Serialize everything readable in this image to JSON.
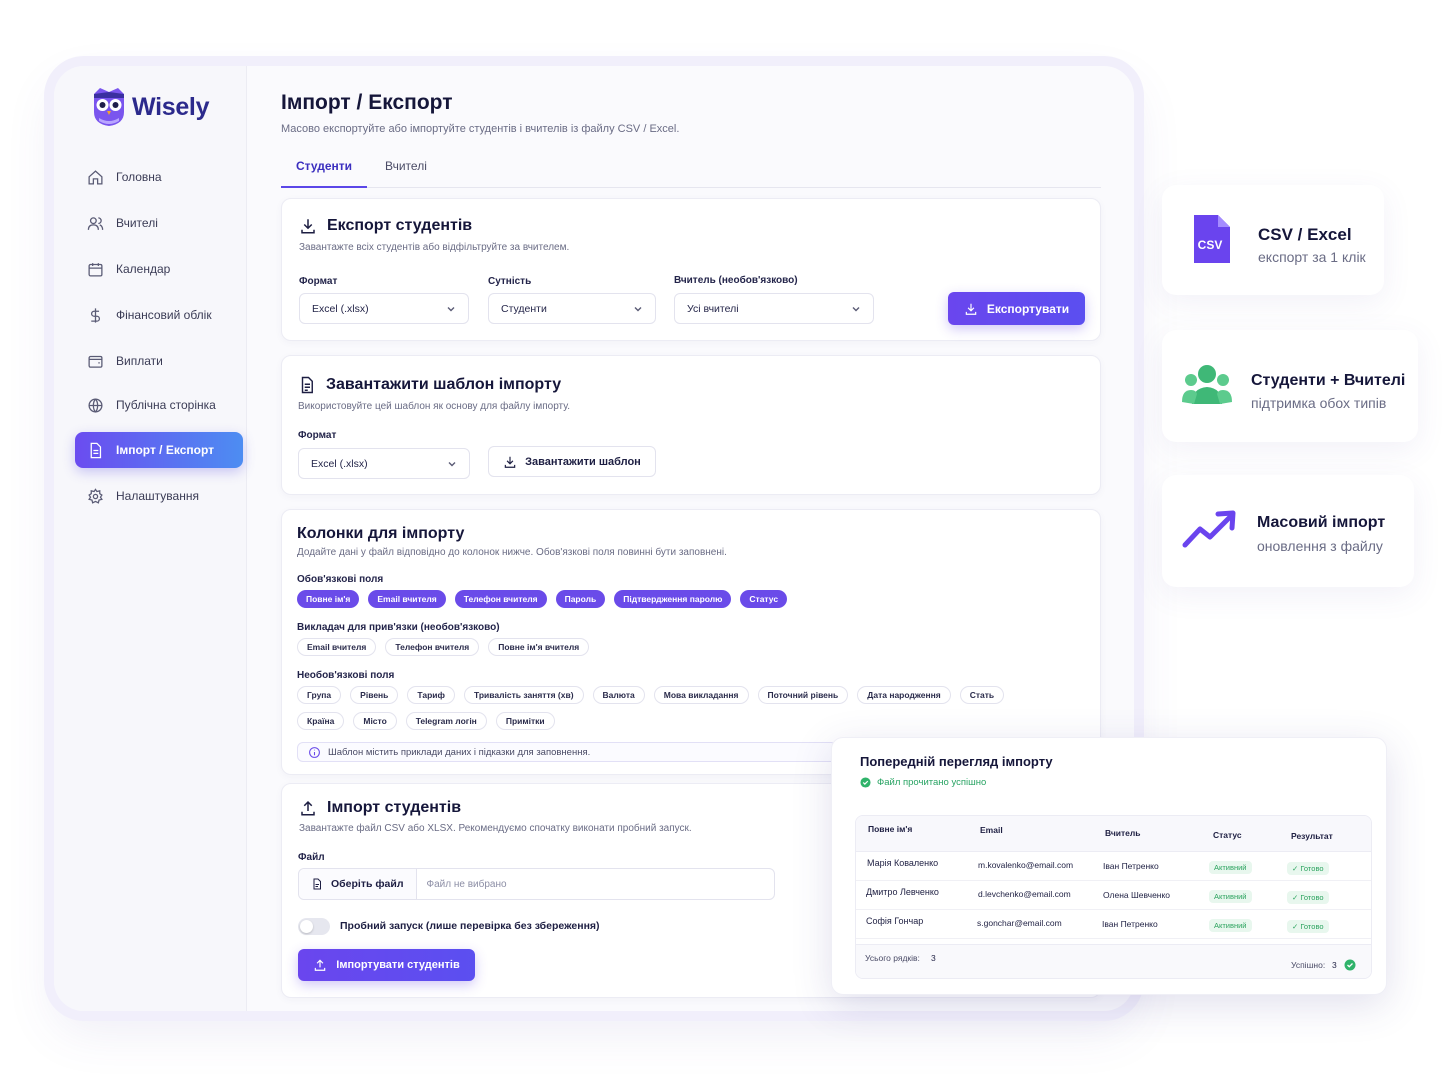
{
  "app": {
    "name": "Wisely"
  },
  "sidebar": {
    "items": [
      {
        "label": "Головна",
        "icon": "home-icon"
      },
      {
        "label": "Вчителі",
        "icon": "users-icon"
      },
      {
        "label": "Календар",
        "icon": "calendar-icon"
      },
      {
        "label": "Фінансовий облік",
        "icon": "dollar-icon"
      },
      {
        "label": "Виплати",
        "icon": "wallet-icon"
      },
      {
        "label": "Публічна сторінка",
        "icon": "globe-icon"
      },
      {
        "label": "Імпорт / Експорт",
        "icon": "file-icon",
        "active": true
      },
      {
        "label": "Налаштування",
        "icon": "gear-icon"
      }
    ]
  },
  "page": {
    "title": "Імпорт / Експорт",
    "subtitle": "Масово експортуйте або імпортуйте студентів і вчителів із файлу CSV / Excel.",
    "tabs": [
      {
        "label": "Студенти",
        "active": true
      },
      {
        "label": "Вчителі",
        "active": false
      }
    ]
  },
  "export_card": {
    "title": "Експорт студентів",
    "subtitle": "Завантажте всіх студентів або відфільтруйте за вчителем.",
    "format_label": "Формат",
    "format_value": "Excel (.xlsx)",
    "entity_label": "Сутність",
    "entity_value": "Студенти",
    "teacher_label": "Вчитель (необов'язково)",
    "teacher_value": "Усі вчителі",
    "button": "Експортувати"
  },
  "template_card": {
    "title": "Завантажити шаблон імпорту",
    "subtitle": "Використовуйте цей шаблон як основу для файлу імпорту.",
    "format_label": "Формат",
    "format_value": "Excel (.xlsx)",
    "button": "Завантажити шаблон"
  },
  "columns_card": {
    "title": "Колонки для імпорту",
    "subtitle": "Додайте дані у файл відповідно до колонок нижче. Обов'язкові поля повинні бути заповнені.",
    "required_label": "Обов'язкові поля",
    "required": [
      "Повне ім'я",
      "Email вчителя",
      "Телефон вчителя",
      "Пароль",
      "Підтвердження паролю",
      "Статус"
    ],
    "teacher_link_label": "Викладач для прив'язки (необов'язково)",
    "teacher_link": [
      "Email вчителя",
      "Телефон вчителя",
      "Повне ім'я вчителя"
    ],
    "optional_label": "Необов'язкові поля",
    "optional": [
      "Група",
      "Рівень",
      "Тариф",
      "Тривалість заняття (хв)",
      "Валюта",
      "Мова викладання",
      "Поточний рівень",
      "Дата народження",
      "Стать",
      "Країна",
      "Місто",
      "Telegram логін",
      "Примітки"
    ],
    "info": "Шаблон містить приклади даних і підказки для заповнення."
  },
  "import_card": {
    "title": "Імпорт студентів",
    "subtitle": "Завантажте файл CSV або XLSX. Рекомендуємо спочатку виконати пробний запуск.",
    "file_label": "Файл",
    "choose_button": "Оберіть файл",
    "no_file": "Файл не вибрано",
    "dry_run_label": "Пробний запуск (лише перевірка без збереження)",
    "dry_run_on": false,
    "button": "Імпортувати студентів"
  },
  "preview": {
    "title": "Попередній перегляд імпорту",
    "status": "Файл прочитано успішно",
    "columns": [
      "Повне ім'я",
      "Email",
      "Вчитель",
      "Статус",
      "Результат"
    ],
    "rows": [
      [
        "Марія Коваленко",
        "m.kovalenko@email.com",
        "Іван Петренко",
        "Активний",
        "✓ Готово"
      ],
      [
        "Дмитро Левченко",
        "d.levchenko@email.com",
        "Олена Шевченко",
        "Активний",
        "✓ Готово"
      ],
      [
        "Софія Гончар",
        "s.gonchar@email.com",
        "Іван Петренко",
        "Активний",
        "✓ Готово"
      ]
    ],
    "total_label": "Усього рядків:",
    "total_value": "3",
    "success_label": "Успішно:",
    "success_value": "3"
  },
  "features": [
    {
      "title": "CSV / Excel",
      "subtitle": "експорт за 1 клік",
      "icon": "csv-file-icon"
    },
    {
      "title": "Студенти + Вчителі",
      "subtitle": "підтримка обох типів",
      "icon": "people-group-icon"
    },
    {
      "title": "Масовий імпорт",
      "subtitle": "оновлення з файлу",
      "icon": "trend-up-icon"
    }
  ],
  "colors": {
    "accent": "#6a4be9",
    "brand": "#2c2a8c",
    "success": "#28a363",
    "accent_blue": "#4d8df2"
  }
}
